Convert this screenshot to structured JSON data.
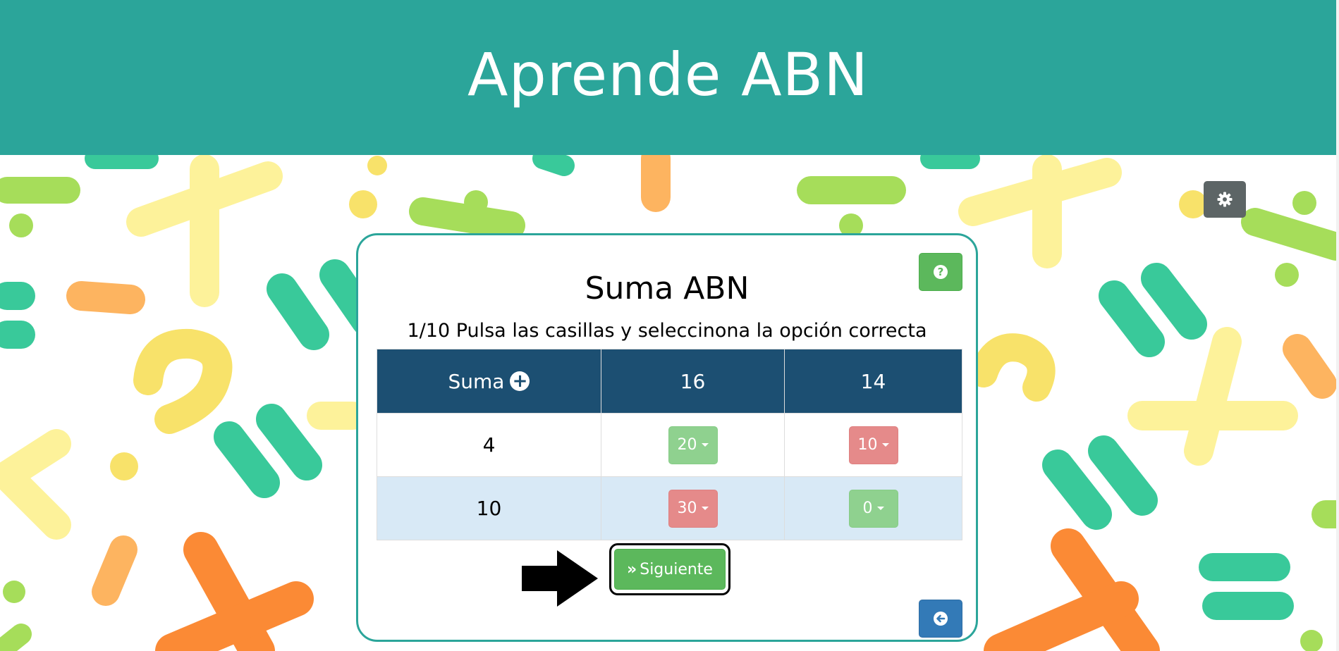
{
  "app": {
    "title": "Aprende ABN"
  },
  "settings": {
    "icon": "gear-icon"
  },
  "card": {
    "title": "Suma ABN",
    "subtitle": "1/10 Pulsa las casillas y seleccinona la opción correcta",
    "help_icon": "question-circle-icon",
    "back_icon": "arrow-circle-left-icon"
  },
  "table": {
    "header": [
      "Suma",
      "16",
      "14"
    ],
    "rows": [
      {
        "label": "4",
        "cells": [
          {
            "value": "20",
            "state": "correct"
          },
          {
            "value": "10",
            "state": "incorrect"
          }
        ]
      },
      {
        "label": "10",
        "cells": [
          {
            "value": "30",
            "state": "incorrect"
          },
          {
            "value": "0",
            "state": "correct"
          }
        ]
      }
    ]
  },
  "next": {
    "label": "Siguiente"
  },
  "colors": {
    "header_bg": "#2ba59a",
    "table_header_bg": "#1c4f72",
    "correct": "#8fd18f",
    "incorrect": "#e58a8a",
    "primary": "#337ab7",
    "success": "#5cb85c"
  }
}
